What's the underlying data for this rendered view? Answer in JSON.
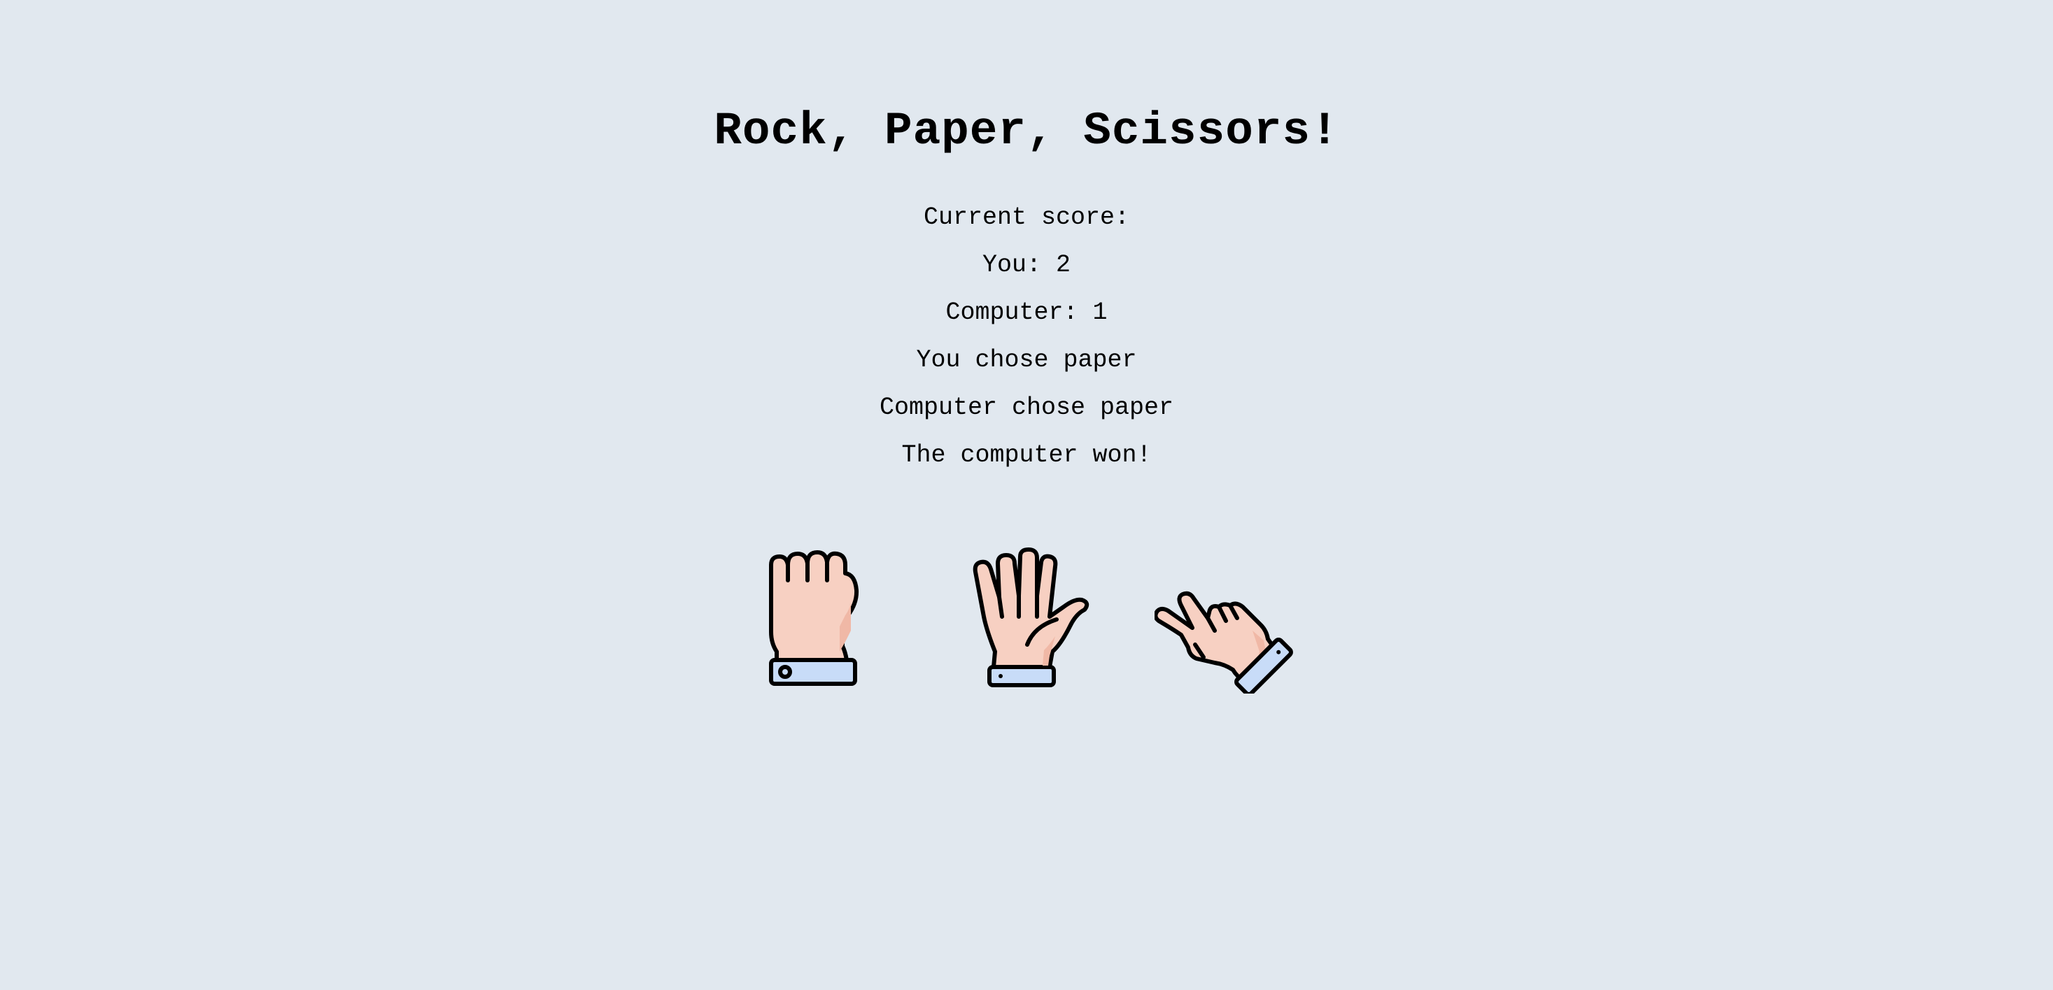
{
  "game": {
    "title": "Rock, Paper, Scissors!",
    "score_heading": "Current score:",
    "player_score_line": "You: 2",
    "computer_score_line": "Computer: 1",
    "player_choice_line": "You chose paper",
    "computer_choice_line": "Computer chose paper",
    "result_line": "The computer won!"
  },
  "choices": [
    {
      "id": "rock",
      "icon": "rock-fist-icon"
    },
    {
      "id": "paper",
      "icon": "paper-open-hand-icon"
    },
    {
      "id": "scissors",
      "icon": "scissors-hand-icon"
    }
  ],
  "colors": {
    "background": "#e1e8ef",
    "skin": "#f7d0c2",
    "skin_shadow": "#f0b8a6",
    "cuff": "#c8dcf8",
    "outline": "#000000"
  }
}
